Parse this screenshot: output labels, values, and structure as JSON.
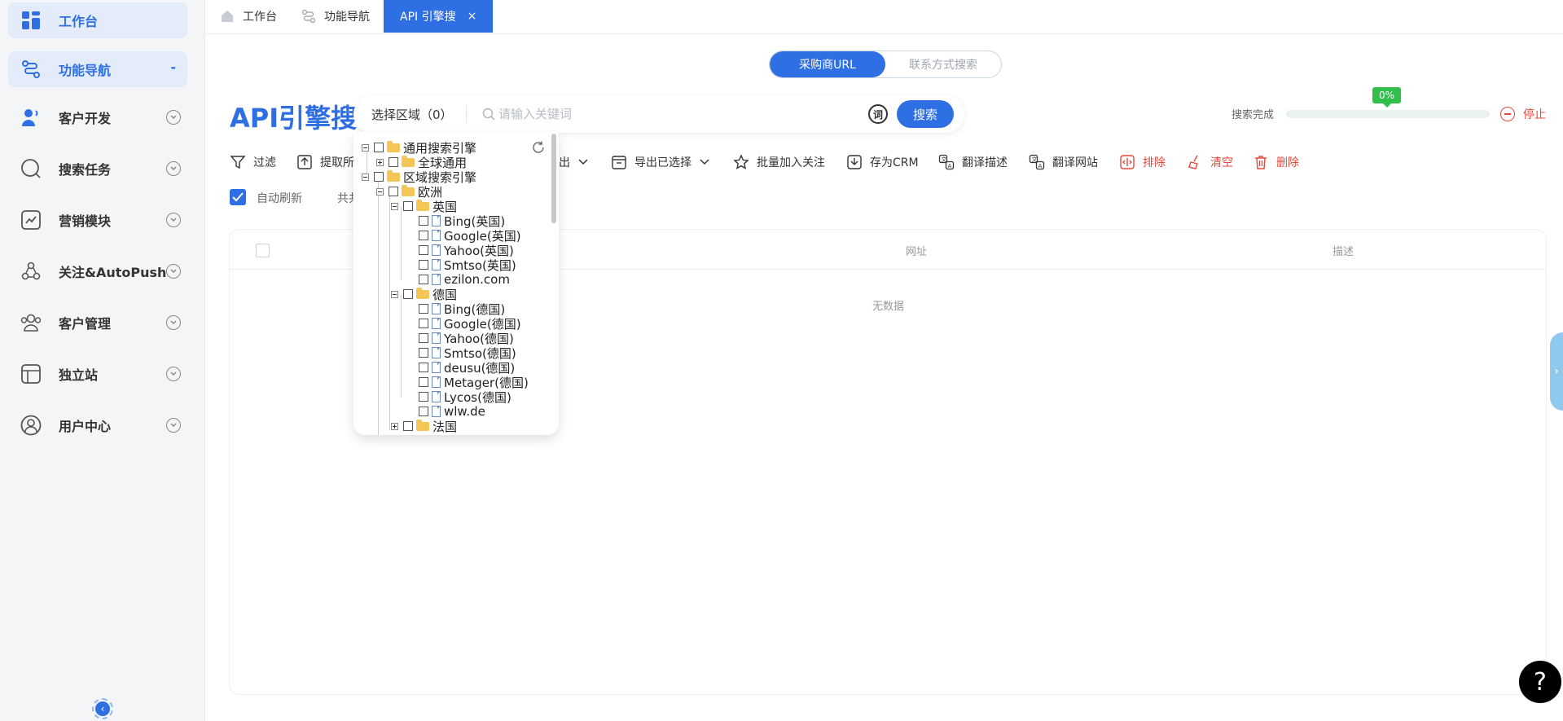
{
  "sidebar": {
    "items": [
      {
        "label": "工作台",
        "icon": "dashboard-icon"
      },
      {
        "label": "功能导航",
        "icon": "route-icon",
        "indicator": "-"
      },
      {
        "label": "客户开发",
        "icon": "user-voice-icon"
      },
      {
        "label": "搜索任务",
        "icon": "search-circle-icon"
      },
      {
        "label": "营销模块",
        "icon": "chart-trend-icon"
      },
      {
        "label": "关注&AutoPush",
        "icon": "network-icon"
      },
      {
        "label": "客户管理",
        "icon": "group-icon"
      },
      {
        "label": "独立站",
        "icon": "browser-window-icon"
      },
      {
        "label": "用户中心",
        "icon": "user-circle-icon"
      }
    ],
    "collapse_symbol": "‹"
  },
  "tabs": [
    {
      "label": "工作台"
    },
    {
      "label": "功能导航"
    },
    {
      "label": "API 引擎搜",
      "close": "×"
    }
  ],
  "mode_switch": {
    "options": [
      "采购商URL",
      "联系方式搜索"
    ],
    "selected": "采购商URL"
  },
  "page_title": "API引擎搜",
  "search": {
    "region_label": "选择区域（0）",
    "placeholder": "请输入关键词",
    "keyword_button": "词",
    "button": "搜索"
  },
  "progress": {
    "label": "搜索完成",
    "percent_text": "0%",
    "value": 0,
    "stop_label": "停止"
  },
  "toolbar": {
    "items": [
      {
        "label": "过滤",
        "icon": "filter-icon"
      },
      {
        "label": "提取所",
        "icon": "export-upload-icon"
      },
      {
        "label": "出",
        "icon": "chevron-down-icon"
      },
      {
        "label": "导出已选择",
        "icon": "archive-icon"
      },
      {
        "label": "批量加入关注",
        "icon": "star-icon"
      },
      {
        "label": "存为CRM",
        "icon": "save-download-icon"
      },
      {
        "label": "翻译描述",
        "icon": "translate-icon"
      },
      {
        "label": "翻译网站",
        "icon": "translate-site-icon"
      },
      {
        "label": "排除",
        "icon": "exclude-icon"
      },
      {
        "label": "清空",
        "icon": "broom-icon"
      },
      {
        "label": "删除",
        "icon": "trash-icon"
      }
    ],
    "auto_refresh_label": "自动刷新",
    "auto_refresh_checked": true,
    "total_label": "共共"
  },
  "table": {
    "columns": [
      "网址",
      "描述"
    ],
    "empty_text": "无数据"
  },
  "region_tree": {
    "nodes": [
      {
        "label": "通用搜索引擎",
        "type": "folder",
        "expanded": true
      },
      {
        "label": "全球通用",
        "type": "folder",
        "expanded": false
      },
      {
        "label": "区域搜索引擎",
        "type": "folder",
        "expanded": true
      },
      {
        "label": "欧洲",
        "type": "folder",
        "expanded": true
      },
      {
        "label": "英国",
        "type": "folder",
        "expanded": true
      },
      {
        "label": "Bing(英国)",
        "type": "file"
      },
      {
        "label": "Google(英国)",
        "type": "file"
      },
      {
        "label": "Yahoo(英国)",
        "type": "file"
      },
      {
        "label": "Smtso(英国)",
        "type": "file"
      },
      {
        "label": "ezilon.com",
        "type": "file"
      },
      {
        "label": "德国",
        "type": "folder",
        "expanded": true
      },
      {
        "label": "Bing(德国)",
        "type": "file"
      },
      {
        "label": "Google(德国)",
        "type": "file"
      },
      {
        "label": "Yahoo(德国)",
        "type": "file"
      },
      {
        "label": "Smtso(德国)",
        "type": "file"
      },
      {
        "label": "deusu(德国)",
        "type": "file"
      },
      {
        "label": "Metager(德国)",
        "type": "file"
      },
      {
        "label": "Lycos(德国)",
        "type": "file"
      },
      {
        "label": "wlw.de",
        "type": "file"
      },
      {
        "label": "法国",
        "type": "folder",
        "expanded": false
      }
    ]
  },
  "help_symbol": "?",
  "side_tab_symbol": "›",
  "colors": {
    "primary": "#2f6fe4",
    "danger": "#e5483b",
    "success": "#2fbf4a"
  }
}
